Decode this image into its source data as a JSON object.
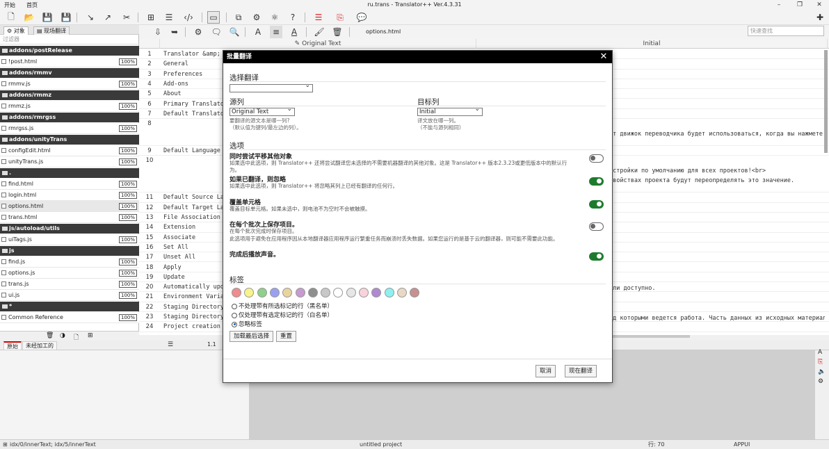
{
  "app": {
    "title": "ru.trans - Translator++ Ver.4.3.31",
    "menu": [
      "开始",
      "首页"
    ]
  },
  "left": {
    "tabs": [
      "对象",
      "现场翻译"
    ],
    "filter_placeholder": "过滤器",
    "rows": [
      {
        "type": "folder",
        "label": "addons/postRelease"
      },
      {
        "type": "file",
        "label": "!post.html",
        "pct": "100%"
      },
      {
        "type": "folder",
        "label": "addons/rmmv"
      },
      {
        "type": "file",
        "label": "rmmv.js",
        "pct": "100%"
      },
      {
        "type": "folder",
        "label": "addons/rmmz"
      },
      {
        "type": "file",
        "label": "rmmz.js",
        "pct": "100%"
      },
      {
        "type": "folder",
        "label": "addons/rmrgss"
      },
      {
        "type": "file",
        "label": "rmrgss.js",
        "pct": "100%"
      },
      {
        "type": "folder",
        "label": "addons/unityTrans"
      },
      {
        "type": "file",
        "label": "configEdit.html",
        "pct": "100%"
      },
      {
        "type": "file",
        "label": "unityTrans.js",
        "pct": "100%"
      },
      {
        "type": "folder",
        "label": "."
      },
      {
        "type": "file",
        "label": "find.html",
        "pct": "100%"
      },
      {
        "type": "file",
        "label": "login.html",
        "pct": "100%"
      },
      {
        "type": "file",
        "label": "options.html",
        "pct": "100%",
        "selected": true
      },
      {
        "type": "file",
        "label": "trans.html",
        "pct": "100%"
      },
      {
        "type": "folder",
        "label": "js/autoload/utils"
      },
      {
        "type": "file",
        "label": "uiTags.js",
        "pct": "100%"
      },
      {
        "type": "folder",
        "label": "js"
      },
      {
        "type": "file",
        "label": "find.js",
        "pct": "100%"
      },
      {
        "type": "file",
        "label": "options.js",
        "pct": "100%"
      },
      {
        "type": "file",
        "label": "trans.js",
        "pct": "100%"
      },
      {
        "type": "file",
        "label": "ui.js",
        "pct": "100%"
      },
      {
        "type": "folder",
        "label": "*"
      },
      {
        "type": "file",
        "label": "Common Reference",
        "pct": "100%"
      }
    ]
  },
  "toolbar2": {
    "filename": "options.html",
    "quick_search": "快速查找"
  },
  "grid": {
    "col_original": "Original Text",
    "col_initial": "Initial",
    "rows": [
      {
        "n": "1",
        "t": "Translator &amp; La"
      },
      {
        "n": "2",
        "t": "General"
      },
      {
        "n": "3",
        "t": "Preferences"
      },
      {
        "n": "4",
        "t": "Add-ons"
      },
      {
        "n": "5",
        "t": "About"
      },
      {
        "n": "6",
        "t": "Primary Translator"
      },
      {
        "n": "7",
        "t": "Default Translator"
      },
      {
        "n": "8",
        "t": ""
      },
      {
        "n": "9",
        "t": "Default Language"
      },
      {
        "n": "10",
        "t": ""
      },
      {
        "n": "11",
        "t": "Default Source Lang"
      },
      {
        "n": "12",
        "t": "Default Target Lang"
      },
      {
        "n": "13",
        "t": "File Association"
      },
      {
        "n": "14",
        "t": "Extension"
      },
      {
        "n": "15",
        "t": "Associate"
      },
      {
        "n": "16",
        "t": "Set All"
      },
      {
        "n": "17",
        "t": "Unset All"
      },
      {
        "n": "18",
        "t": "Apply"
      },
      {
        "n": "19",
        "t": "Update"
      },
      {
        "n": "20",
        "t": "Automatically updat"
      },
      {
        "n": "21",
        "t": "Environment Variabl"
      },
      {
        "n": "22",
        "t": "Staging Directory"
      },
      {
        "n": "23",
        "t": "Staging Directory i"
      },
      {
        "n": "24",
        "t": "Project creation"
      }
    ],
    "side": {
      "r8": "от движок переводчика будет использоваться, когда вы нажмете кнопку",
      "r10a": "астройки по умолчанию для всех проектов!<br>",
      "r10b": "свойствах проекта будут переопределять это значение.",
      "r20": "сли доступно.",
      "r23": "ад которыми ведется работа. Часть данных из исходных материалов ко"
    }
  },
  "bottom": {
    "tabs": [
      "原始",
      "未经加工的"
    ],
    "pos": "1.1"
  },
  "status": {
    "path": "idx/0/innerText; idx/5/innerText",
    "project": "untitled project",
    "row": "行: 70",
    "mode": "APPUI"
  },
  "dialog": {
    "title": "批量翻译",
    "select_translation": "选择翻译",
    "source_col": "源列",
    "source_value": "Original Text",
    "source_desc1": "要翻译的源文本是哪一列?",
    "source_desc2": "（默认值为键列/最左边的列）。",
    "target_col": "目标列",
    "target_value": "Initial",
    "target_desc1": "译文放在哪一列。",
    "target_desc2": "（不能与源列相同）",
    "options_h": "选项",
    "options": [
      {
        "title": "同时尝试平移其他对象",
        "desc": "如果选中此选项，则 Translator++ 还将尝试翻译您未选择的不需要机器翻译的其他对象。这是 Translator++ 版本2.3.23或更低版本中的默认行为。",
        "desc2": "",
        "on": false
      },
      {
        "title": "如果已翻译，则忽略",
        "desc": "如果选中此选项，则 Translator++ 将忽略其列上已经有翻译的任何行。",
        "desc2": "",
        "on": true
      },
      {
        "title": "覆盖单元格",
        "desc": "覆盖目标单元格。如果未选中，则电池不为空时不会被触摸。",
        "desc2": "",
        "on": true
      },
      {
        "title": "在每个批次上保存项目。",
        "desc": "在每个批次完成时保存项目。",
        "desc2": "此选项用于避免在应用程序因从本地翻译器应用程序运行繁重任务而崩溃时丢失数据。如果您运行的是基于云的翻译器，则可能不需要此功能。",
        "on": false
      },
      {
        "title": "完成后播放声音。",
        "desc": "",
        "desc2": "",
        "on": true
      }
    ],
    "tags_h": "标签",
    "tag_colors": [
      "#f08c8c",
      "#f8f38a",
      "#8fd08a",
      "#9aa0f0",
      "#e8d4a0",
      "#c89ad0",
      "#8f8f8f",
      "#c8c8c8",
      "#ffffff",
      "#e6e6e6",
      "#f9d3dc",
      "#b08ad0",
      "#8ff0f0",
      "#e8d8c4",
      "#c89090"
    ],
    "radios": [
      {
        "label": "不处理带有所选标记的行（黑名单）",
        "on": false
      },
      {
        "label": "仅处理带有选定标记的行（白名单）",
        "on": false
      },
      {
        "label": "忽略标签",
        "on": true
      }
    ],
    "load_last": "加载最后选择",
    "reset": "重置",
    "cancel": "取消",
    "translate_now": "现在翻译"
  }
}
